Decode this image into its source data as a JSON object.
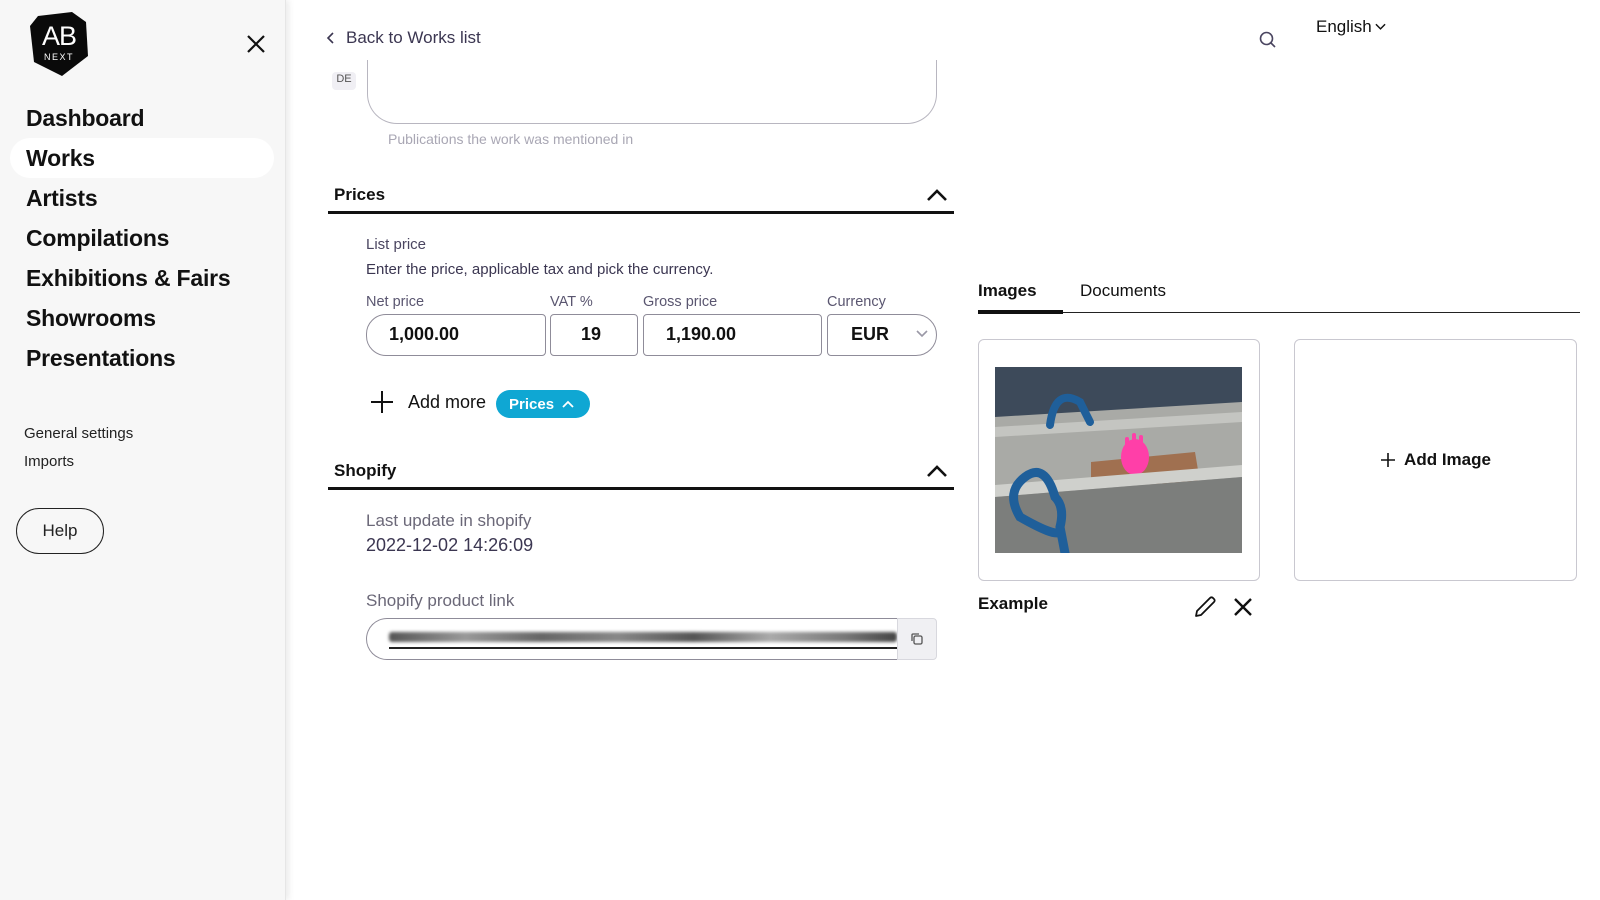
{
  "sidebar": {
    "logo": {
      "main": "AB",
      "sub": "NEXT"
    },
    "nav": [
      {
        "label": "Dashboard",
        "active": false
      },
      {
        "label": "Works",
        "active": true
      },
      {
        "label": "Artists",
        "active": false
      },
      {
        "label": "Compilations",
        "active": false
      },
      {
        "label": "Exhibitions & Fairs",
        "active": false
      },
      {
        "label": "Showrooms",
        "active": false
      },
      {
        "label": "Presentations",
        "active": false
      }
    ],
    "subnav": [
      {
        "label": "General settings"
      },
      {
        "label": "Imports"
      }
    ],
    "help_label": "Help"
  },
  "topbar": {
    "back_label": "Back to Works list",
    "language": "English"
  },
  "publications": {
    "lang_tag": "DE",
    "value": "",
    "helper": "Publications the work was mentioned in"
  },
  "prices": {
    "title": "Prices",
    "expanded": true,
    "list_price_label": "List price",
    "list_price_help": "Enter the price, applicable tax and pick the currency.",
    "fields": {
      "net_label": "Net price",
      "net_value": "1,000.00",
      "vat_label": "VAT %",
      "vat_value": "19",
      "gross_label": "Gross price",
      "gross_value": "1,190.00",
      "currency_label": "Currency",
      "currency_value": "EUR"
    },
    "add_more_label": "Add more",
    "chip_label": "Prices"
  },
  "shopify": {
    "title": "Shopify",
    "expanded": true,
    "last_update_label": "Last update in shopify",
    "last_update_value": "2022-12-02 14:26:09",
    "product_link_label": "Shopify product link",
    "product_link_value": "[redacted]"
  },
  "media": {
    "tabs": [
      {
        "label": "Images",
        "active": true
      },
      {
        "label": "Documents",
        "active": false
      }
    ],
    "images": [
      {
        "caption": "Example"
      }
    ],
    "add_image_label": "Add Image"
  },
  "colors": {
    "accent": "#0fa7d3",
    "sidebar_bg": "#f7f7f7",
    "text_primary": "#111111",
    "text_muted": "#6b6878"
  }
}
